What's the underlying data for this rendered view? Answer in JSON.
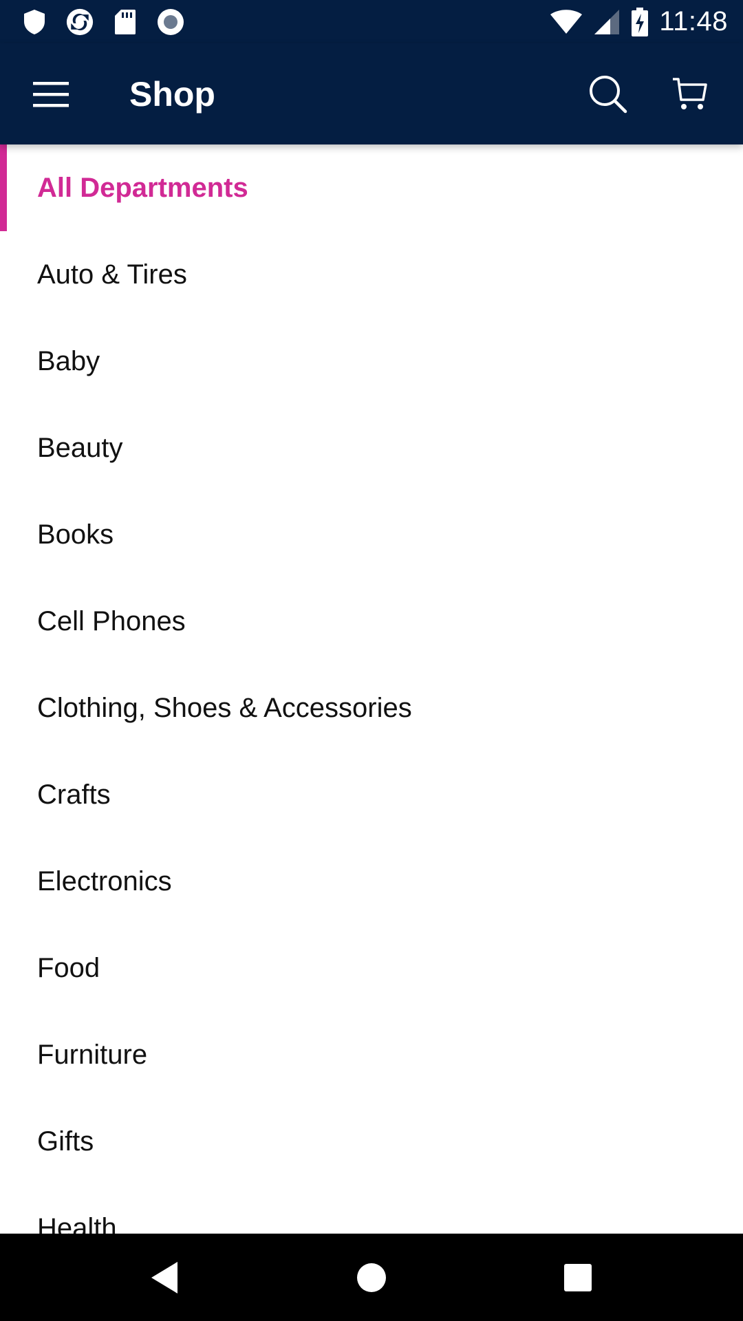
{
  "status_bar": {
    "time": "11:48",
    "left_icons": [
      "shield-icon",
      "sync-icon",
      "sd-card-icon",
      "record-icon"
    ],
    "right_icons": [
      "wifi-icon",
      "signal-icon",
      "battery-charging-icon"
    ]
  },
  "app_bar": {
    "title": "Shop",
    "menu_icon": "menu-icon",
    "search_icon": "search-icon",
    "cart_icon": "cart-icon",
    "background": "#041e42"
  },
  "departments": {
    "selected_index": 0,
    "accent_color": "#d12a95",
    "items": [
      {
        "label": "All Departments"
      },
      {
        "label": "Auto & Tires"
      },
      {
        "label": "Baby"
      },
      {
        "label": "Beauty"
      },
      {
        "label": "Books"
      },
      {
        "label": "Cell Phones"
      },
      {
        "label": "Clothing, Shoes & Accessories"
      },
      {
        "label": "Crafts"
      },
      {
        "label": "Electronics"
      },
      {
        "label": "Food"
      },
      {
        "label": "Furniture"
      },
      {
        "label": "Gifts"
      },
      {
        "label": "Health"
      }
    ]
  },
  "nav_bar": {
    "icons": [
      "back-icon",
      "home-icon",
      "recents-icon"
    ]
  }
}
